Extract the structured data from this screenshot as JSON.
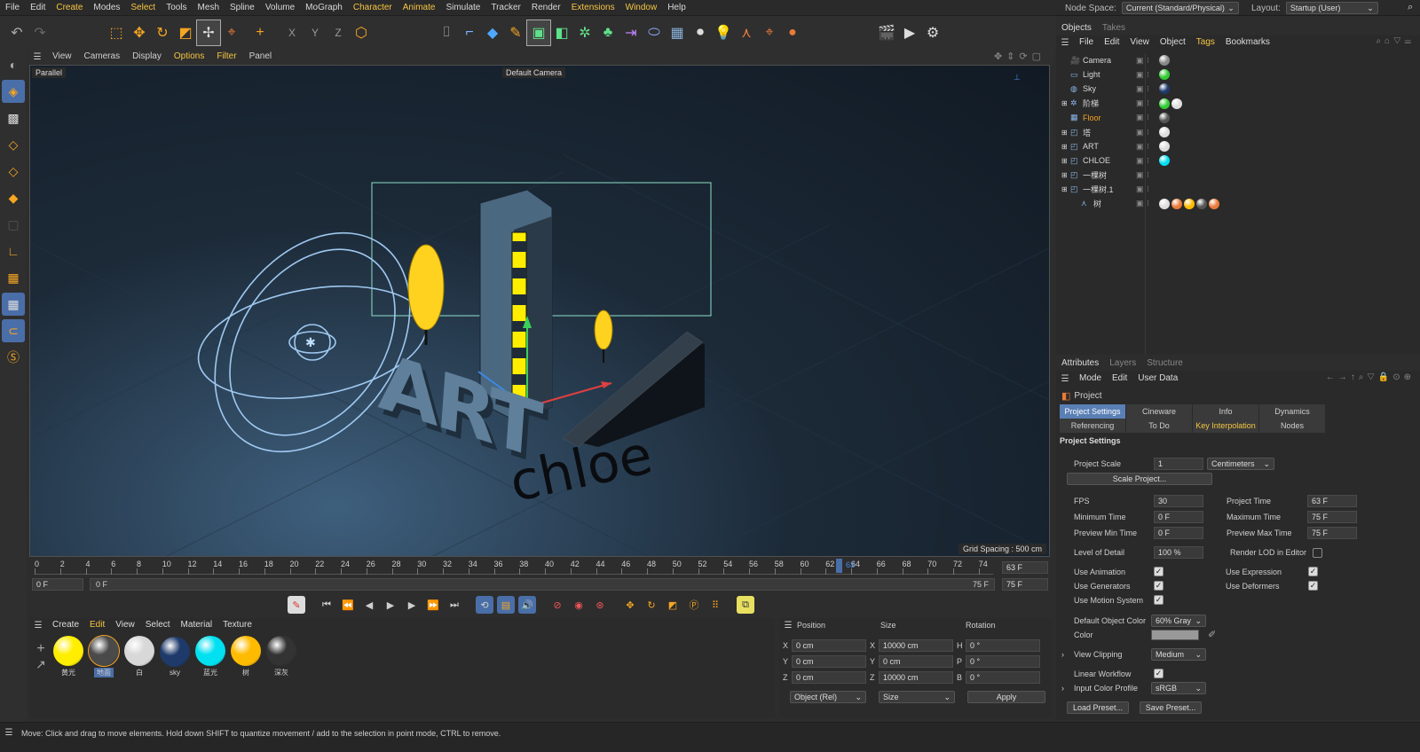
{
  "menubar": {
    "items": [
      "File",
      "Edit",
      "Create",
      "Modes",
      "Select",
      "Tools",
      "Mesh",
      "Spline",
      "Volume",
      "MoGraph",
      "Character",
      "Animate",
      "Simulate",
      "Tracker",
      "Render",
      "Extensions",
      "Window",
      "Help"
    ],
    "node_space_label": "Node Space:",
    "node_space_value": "Current (Standard/Physical)",
    "layout_label": "Layout:",
    "layout_value": "Startup (User)"
  },
  "viewport": {
    "menu": [
      "View",
      "Cameras",
      "Display",
      "Options",
      "Filter",
      "Panel"
    ],
    "projection": "Parallel",
    "camera": "Default Camera",
    "grid_spacing": "Grid Spacing : 500 cm",
    "text_art": "ART",
    "text_chloe": "chloe"
  },
  "timeline": {
    "ticks": [
      "0",
      "2",
      "4",
      "6",
      "8",
      "10",
      "12",
      "14",
      "16",
      "18",
      "20",
      "22",
      "24",
      "26",
      "28",
      "30",
      "32",
      "34",
      "36",
      "38",
      "40",
      "42",
      "44",
      "46",
      "48",
      "50",
      "52",
      "54",
      "56",
      "58",
      "60",
      "62",
      "64",
      "66",
      "68",
      "70",
      "72",
      "74"
    ],
    "current_frame": "63",
    "current_field": "63 F",
    "start": "0 F",
    "range_start": "0 F",
    "range_end": "75 F",
    "end": "75 F"
  },
  "material_manager": {
    "menu": [
      "Create",
      "Edit",
      "View",
      "Select",
      "Material",
      "Texture"
    ],
    "materials": [
      {
        "name": "黄光",
        "color": "#ffee00"
      },
      {
        "name": "地面",
        "color": "#4a4a4a"
      },
      {
        "name": "白",
        "color": "#d8d8d8"
      },
      {
        "name": "sky",
        "color": "#1e3a6a"
      },
      {
        "name": "蓝光",
        "color": "#00e0f0"
      },
      {
        "name": "树",
        "color": "#ffbb00"
      },
      {
        "name": "深灰",
        "color": "#333333"
      }
    ]
  },
  "coords": {
    "headers": [
      "Position",
      "Size",
      "Rotation"
    ],
    "rows": [
      {
        "axis": "X",
        "pos": "0 cm",
        "saxis": "X",
        "size": "10000 cm",
        "raxis": "H",
        "rot": "0 °"
      },
      {
        "axis": "Y",
        "pos": "0 cm",
        "saxis": "Y",
        "size": "0 cm",
        "raxis": "P",
        "rot": "0 °"
      },
      {
        "axis": "Z",
        "pos": "0 cm",
        "saxis": "Z",
        "size": "10000 cm",
        "raxis": "B",
        "rot": "0 °"
      }
    ],
    "mode": "Object (Rel)",
    "size_mode": "Size",
    "apply": "Apply"
  },
  "objects_panel": {
    "tabs": [
      "Objects",
      "Takes"
    ],
    "menu": [
      "File",
      "Edit",
      "View",
      "Object",
      "Tags",
      "Bookmarks"
    ],
    "items": [
      {
        "name": "Camera",
        "color": "#d8d8d8"
      },
      {
        "name": "Light",
        "color": "#d8d8d8"
      },
      {
        "name": "Sky",
        "color": "#d8d8d8"
      },
      {
        "name": "阶梯",
        "color": "#d8d8d8"
      },
      {
        "name": "Floor",
        "color": "#f5a623"
      },
      {
        "name": "塔",
        "color": "#d8d8d8"
      },
      {
        "name": "ART",
        "color": "#d8d8d8"
      },
      {
        "name": "CHLOE",
        "color": "#d8d8d8"
      },
      {
        "name": "一棵树",
        "color": "#d8d8d8"
      },
      {
        "name": "一棵树.1",
        "color": "#d8d8d8"
      },
      {
        "name": "树",
        "color": "#d8d8d8"
      }
    ]
  },
  "attributes": {
    "tabs": [
      "Attributes",
      "Layers",
      "Structure"
    ],
    "menu": [
      "Mode",
      "Edit",
      "User Data"
    ],
    "title": "Project",
    "subtabs1": [
      "Project Settings",
      "Cineware",
      "Info",
      "Dynamics"
    ],
    "subtabs2": [
      "Referencing",
      "To Do",
      "Key Interpolation",
      "Nodes"
    ],
    "section": "Project Settings",
    "project_scale_label": "Project Scale",
    "project_scale_value": "1",
    "units": "Centimeters",
    "scale_project": "Scale Project...",
    "fps_label": "FPS",
    "fps": "30",
    "project_time_label": "Project Time",
    "project_time": "63 F",
    "min_time_label": "Minimum Time",
    "min_time": "0 F",
    "max_time_label": "Maximum Time",
    "max_time": "75 F",
    "prev_min_label": "Preview Min Time",
    "prev_min": "0 F",
    "prev_max_label": "Preview Max Time",
    "prev_max": "75 F",
    "lod_label": "Level of Detail",
    "lod": "100 %",
    "render_lod_label": "Render LOD in Editor",
    "use_animation": "Use Animation",
    "use_expression": "Use Expression",
    "use_generators": "Use Generators",
    "use_deformers": "Use Deformers",
    "use_motion": "Use Motion System",
    "default_color_label": "Default Object Color",
    "default_color": "60% Gray",
    "color_label": "Color",
    "view_clipping_label": "View Clipping",
    "view_clipping": "Medium",
    "linear_workflow": "Linear Workflow",
    "input_profile_label": "Input Color Profile",
    "input_profile": "sRGB",
    "load_preset": "Load Preset...",
    "save_preset": "Save Preset..."
  },
  "status": "Move: Click and drag to move elements. Hold down SHIFT to quantize movement / add to the selection in point mode, CTRL to remove."
}
